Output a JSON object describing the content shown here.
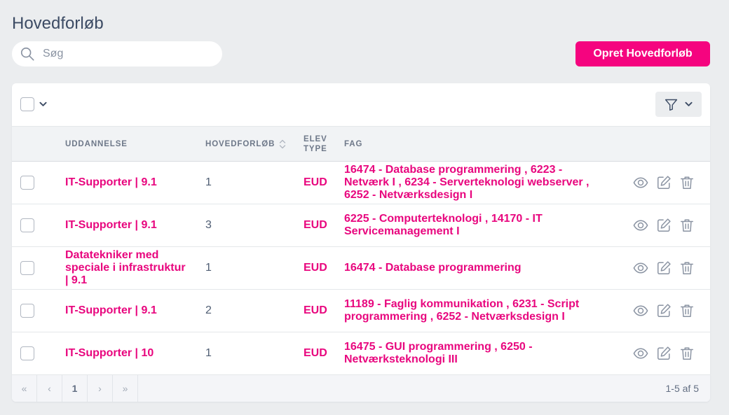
{
  "page": {
    "title": "Hovedforløb"
  },
  "search": {
    "placeholder": "Søg",
    "value": "",
    "icon": "search-icon"
  },
  "header_actions": {
    "create_label": "Opret Hovedforløb"
  },
  "colors": {
    "background": "#ebedef",
    "accent": "#f5047f",
    "link": "#e8067e",
    "title": "#3c4b64",
    "muted_icon": "#8a93a2"
  },
  "toolbar": {
    "select_all_checked": false,
    "bulk_actions_icon": "chevron-down-icon",
    "filter_icon": "filter-icon",
    "filter_menu_icon": "chevron-down-icon"
  },
  "table": {
    "columns": {
      "uddannelse": "UDDANNELSE",
      "hovedforloeb": "HOVEDFORLØB",
      "elev_type": "ELEV TYPE",
      "fag": "FAG"
    },
    "sortable_column_icon": "sort-icon",
    "row_action_icons": [
      "eye-icon",
      "edit-icon",
      "trash-icon"
    ],
    "rows": [
      {
        "checked": false,
        "uddannelse": "IT-Supporter | 9.1",
        "hovedforloeb": 1,
        "elev_type": "EUD",
        "fag": "16474 - Database programmering , 6223 - Netværk I , 6234 - Serverteknologi webserver , 6252 - Netværksdesign I"
      },
      {
        "checked": false,
        "uddannelse": "IT-Supporter | 9.1",
        "hovedforloeb": 3,
        "elev_type": "EUD",
        "fag": "6225 - Computerteknologi , 14170 - IT Servicemanagement I"
      },
      {
        "checked": false,
        "uddannelse": "Datatekniker med speciale i infrastruktur | 9.1",
        "hovedforloeb": 1,
        "elev_type": "EUD",
        "fag": "16474 - Database programmering"
      },
      {
        "checked": false,
        "uddannelse": "IT-Supporter | 9.1",
        "hovedforloeb": 2,
        "elev_type": "EUD",
        "fag": "11189 - Faglig kommunikation , 6231 - Script programmering , 6252 - Netværksdesign I"
      },
      {
        "checked": false,
        "uddannelse": "IT-Supporter | 10",
        "hovedforloeb": 1,
        "elev_type": "EUD",
        "fag": "16475 - GUI programmering , 6250 - Netværksteknologi III"
      }
    ]
  },
  "pagination": {
    "first": "«",
    "prev": "‹",
    "current_page": "1",
    "next": "›",
    "last": "»",
    "summary": "1-5 af 5"
  }
}
